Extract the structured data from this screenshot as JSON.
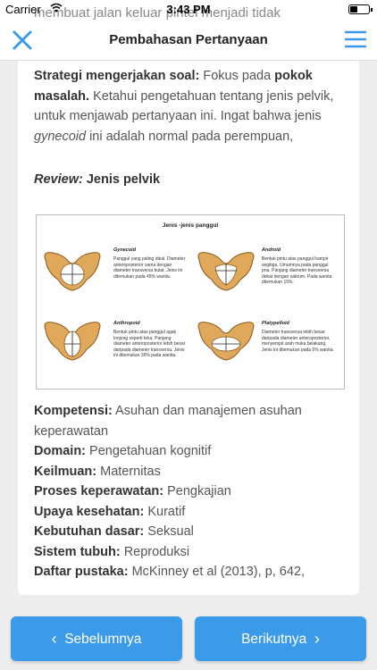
{
  "status": {
    "carrier": "Carrier",
    "time": "3:43 PM",
    "behind_text": "membuat jalan keluar pintel menjadi tidak"
  },
  "nav": {
    "title": "Pembahasan Pertanyaan"
  },
  "content": {
    "strategy_label": "Strategi mengerjakan soal:",
    "strategy_text_1": " Fokus pada ",
    "strategy_bold": "pokok masalah.",
    "strategy_text_2": " Ketahui pengetahuan tentang jenis pelvik, untuk menjawab pertanyaan ini. Ingat bahwa jenis ",
    "strategy_italic": "gynecoid",
    "strategy_text_3": " ini adalah normal pada perempuan,",
    "review_label": "Review:",
    "review_title": " Jenis pelvik"
  },
  "figure": {
    "title": "Jenis -jenis panggul",
    "types": [
      {
        "name": "Gynecoid",
        "desc": "Panggul yang paling ideal. Diameter anteroposterior sama dengan diameter transversa bulat. Jenis ini ditemukan pada 45% wanita."
      },
      {
        "name": "Android",
        "desc": "Bentuk pintu atas panggul hampir segitiga. Umumnya pada panggul pria. Panjang diameter transversa dekat dengan sakrum. Pada wanita ditemukan 15%."
      },
      {
        "name": "Anthropoid",
        "desc": "Bentuk pintu atas panggul agak lonjong seperti telur. Panjang diameter anteroposterior lebih besar daripada diameter transversa. Jenis ini ditemukan 35% pada wanita."
      },
      {
        "name": "Platypelloid",
        "desc": "Diameter transversa lebih besar daripada diameter anteroposterior, menyempit arah muka belakang. Jenis ini ditemukan pada 5% wanita."
      }
    ]
  },
  "meta": [
    {
      "label": "Kompetensi:",
      "value": " Asuhan dan manajemen asuhan keperawatan"
    },
    {
      "label": "Domain:",
      "value": " Pengetahuan kognitif"
    },
    {
      "label": "Keilmuan:",
      "value": " Maternitas"
    },
    {
      "label": "Proses keperawatan:",
      "value": " Pengkajian"
    },
    {
      "label": "Upaya kesehatan:",
      "value": " Kuratif"
    },
    {
      "label": "Kebutuhan dasar:",
      "value": " Seksual"
    },
    {
      "label": "Sistem tubuh:",
      "value": " Reproduksi"
    },
    {
      "label": "Daftar pustaka:",
      "value": " McKinney et al (2013), p, 642,"
    }
  ],
  "footer": {
    "prev_label": "Sebelumnya",
    "next_label": "Berikutnya"
  },
  "colors": {
    "accent": "#3b9be8",
    "bone": "#e0a85a"
  },
  "icons": [
    "close-icon",
    "menu-icon",
    "wifi-icon",
    "battery-icon",
    "chevron-left-icon",
    "chevron-right-icon"
  ]
}
